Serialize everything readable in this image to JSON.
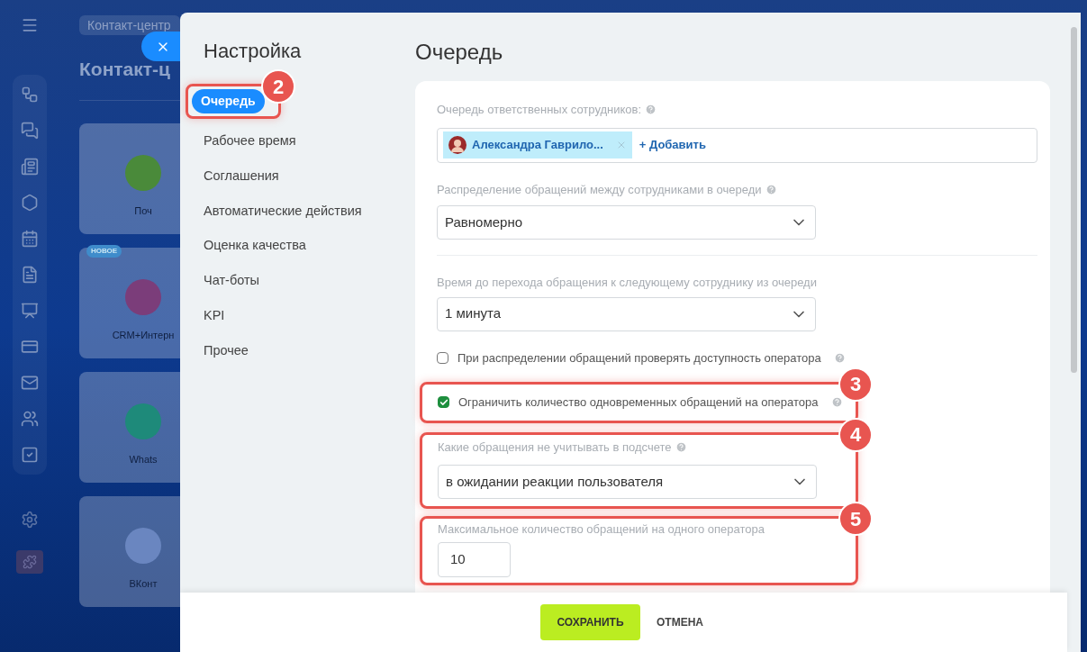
{
  "background_page": {
    "breadcrumb": "Контакт-центр",
    "title": "Контакт-ц",
    "cards": [
      {
        "label": "Поч"
      },
      {
        "label": "CRM+Интерн",
        "badge": "НОВОЕ"
      },
      {
        "label": "Whats"
      },
      {
        "label": "ВКонт"
      }
    ]
  },
  "settings": {
    "title": "Настройка",
    "nav": [
      {
        "label": "Очередь",
        "selected": true,
        "callout": "2"
      },
      {
        "label": "Рабочее время",
        "selected": false
      },
      {
        "label": "Соглашения",
        "selected": false
      },
      {
        "label": "Автоматические действия",
        "selected": false
      },
      {
        "label": "Оценка качества",
        "selected": false
      },
      {
        "label": "Чат-боты",
        "selected": false
      },
      {
        "label": "KPI",
        "selected": false
      },
      {
        "label": "Прочее",
        "selected": false
      }
    ]
  },
  "content": {
    "title": "Очередь",
    "queue": {
      "label": "Очередь ответственных сотрудников:",
      "employee": "Александра Гаврило...",
      "add": "+ Добавить"
    },
    "distribution": {
      "label": "Распределение обращений между сотрудниками в очереди",
      "value": "Равномерно"
    },
    "timeout": {
      "label": "Время до перехода обращения к следующему сотруднику из очереди",
      "value": "1 минута"
    },
    "checks": [
      {
        "label": "При распределении обращений проверять доступность оператора",
        "checked": false
      },
      {
        "label": "Ограничить количество одновременных обращений на оператора",
        "checked": true,
        "callout": "3"
      }
    ],
    "exclude": {
      "label": "Какие обращения не учитывать в подсчете",
      "value": "в ожидании реакции пользователя",
      "callout": "4"
    },
    "max": {
      "label": "Максимальное количество обращений на одного оператора",
      "value": "10",
      "callout": "5"
    }
  },
  "footer": {
    "save": "СОХРАНИТЬ",
    "cancel": "ОТМЕНА"
  }
}
